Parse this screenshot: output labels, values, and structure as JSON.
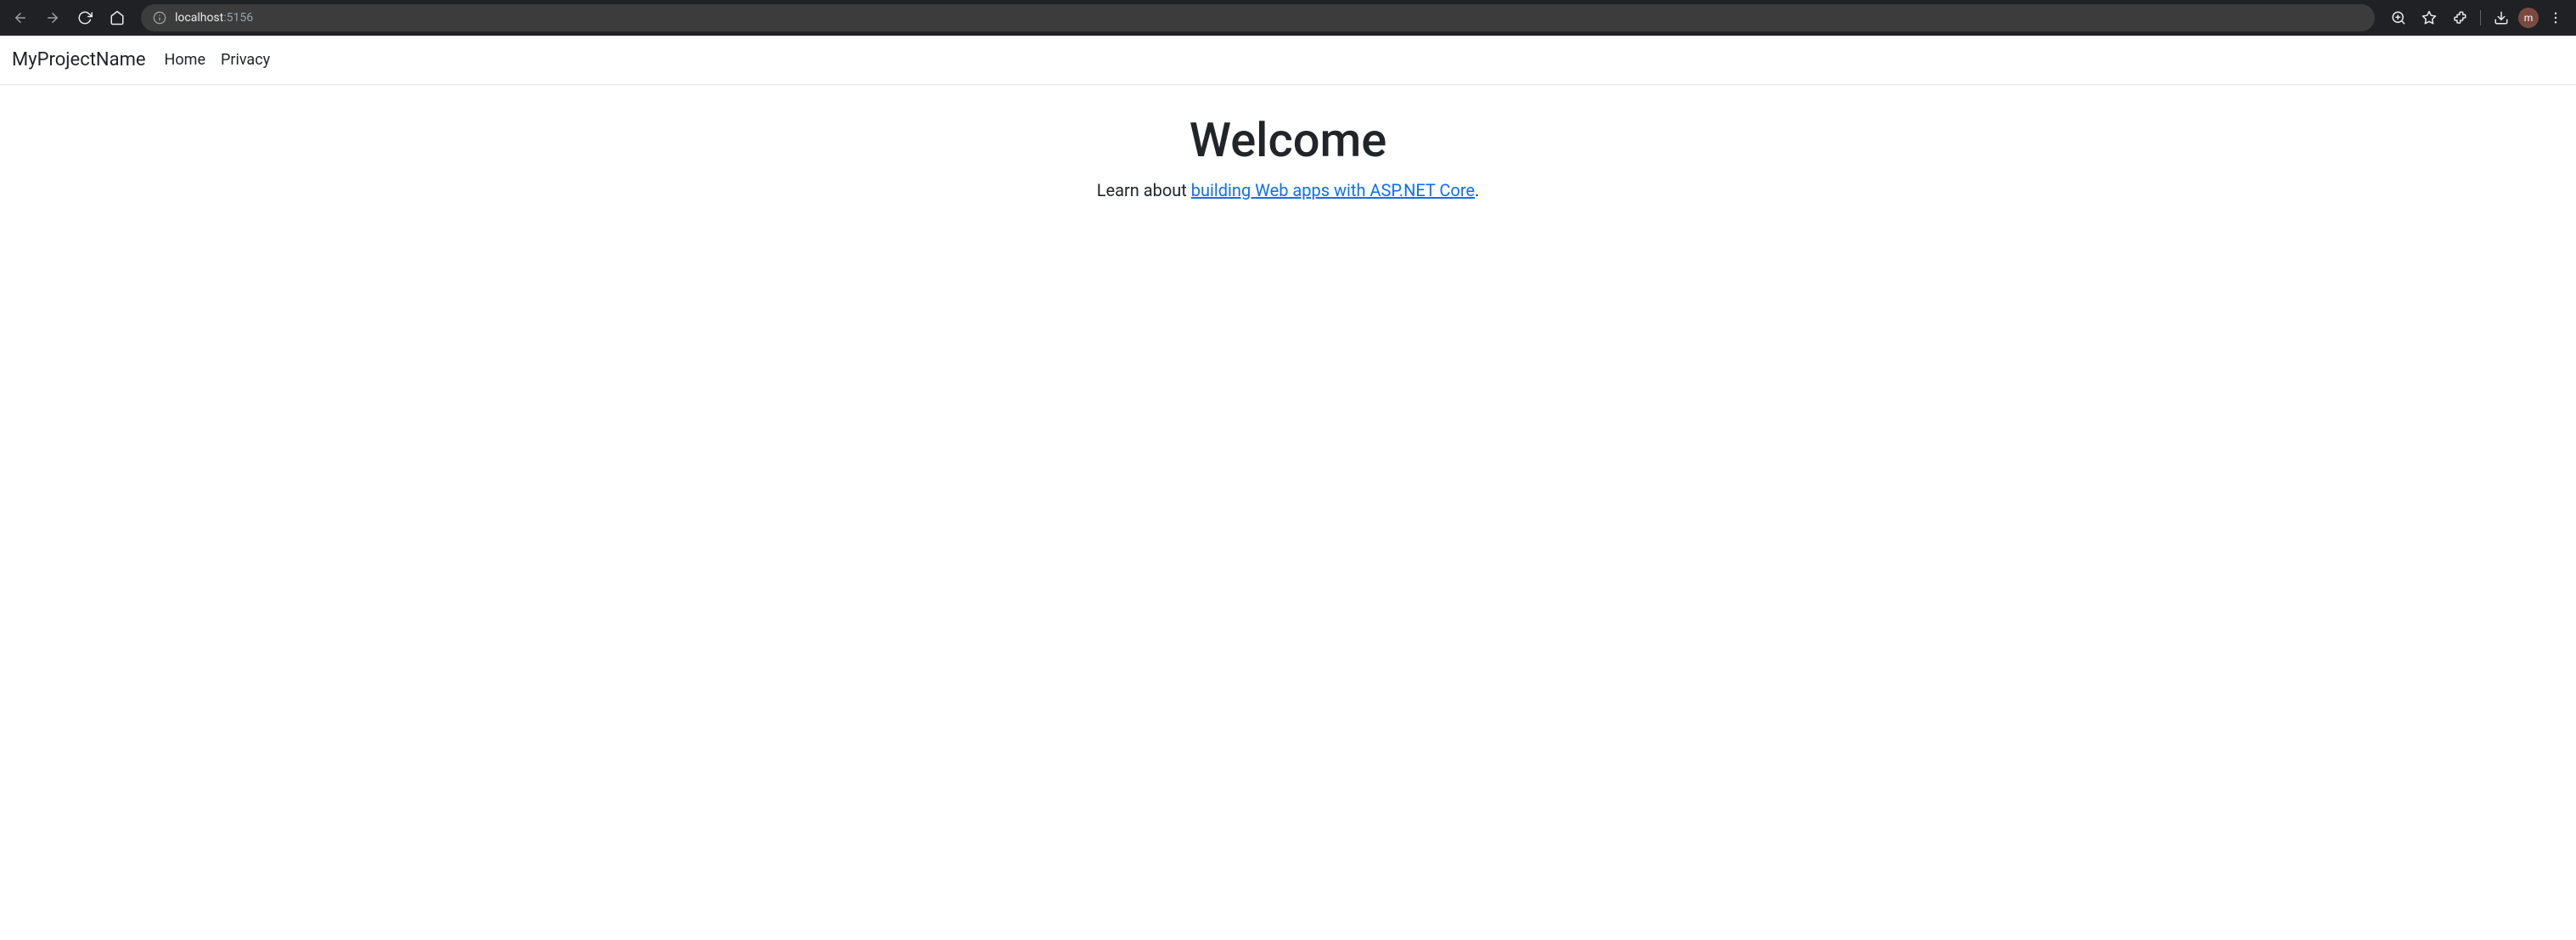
{
  "browser": {
    "url_host": "localhost",
    "url_port": ":5156",
    "profile_initial": "m"
  },
  "nav": {
    "brand": "MyProjectName",
    "links": [
      "Home",
      "Privacy"
    ]
  },
  "main": {
    "title": "Welcome",
    "lead_prefix": "Learn about ",
    "lead_link": "building Web apps with ASP.NET Core",
    "lead_suffix": "."
  }
}
